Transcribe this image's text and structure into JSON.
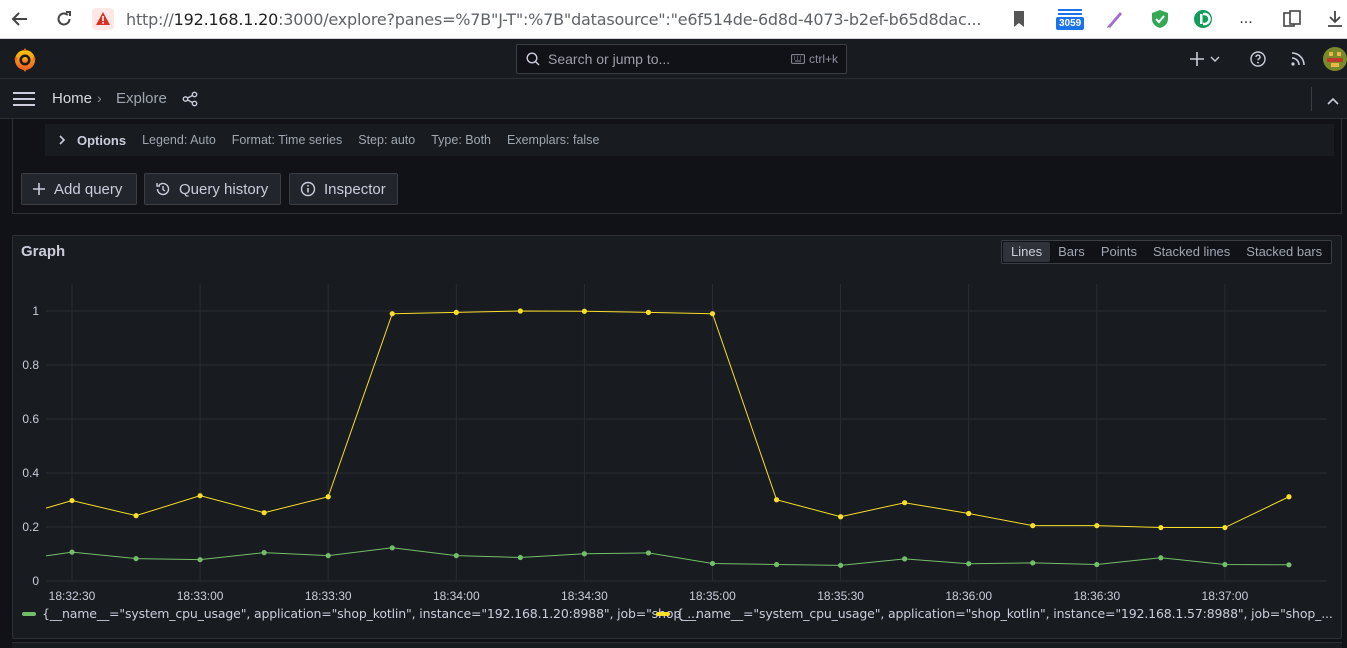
{
  "browser": {
    "url_prefix": "http://",
    "url_host": "192.168.1.20",
    "url_rest": ":3000/explore?panes=%7B\"J-T\":%7B\"datasource\":\"e6f514de-6d8d-4073-b2ef-b65d8dac...",
    "ext_badge": "3059",
    "more_label": "..."
  },
  "topbar": {
    "search_placeholder": "Search or jump to...",
    "search_shortcut": "ctrl+k"
  },
  "breadcrumb": {
    "home": "Home",
    "sep": "›",
    "current": "Explore"
  },
  "options": {
    "title": "Options",
    "items": [
      "Legend: Auto",
      "Format: Time series",
      "Step: auto",
      "Type: Both",
      "Exemplars: false"
    ]
  },
  "actions": {
    "add_query": "Add query",
    "query_history": "Query history",
    "inspector": "Inspector"
  },
  "graph": {
    "title": "Graph",
    "view_modes": [
      "Lines",
      "Bars",
      "Points",
      "Stacked lines",
      "Stacked bars"
    ],
    "active_mode": "Lines"
  },
  "colors": {
    "series_green": "#73bf69",
    "series_yellow": "#fade2a"
  },
  "chart_data": {
    "type": "line",
    "title": "",
    "xlabel": "",
    "ylabel": "",
    "ylim": [
      0,
      1.1
    ],
    "y_ticks": [
      "0",
      "0.2",
      "0.4",
      "0.6",
      "0.8",
      "1"
    ],
    "y_tick_values": [
      0,
      0.2,
      0.4,
      0.6,
      0.8,
      1
    ],
    "x_ticks": [
      "18:32:30",
      "18:33:00",
      "18:33:30",
      "18:34:00",
      "18:34:30",
      "18:35:00",
      "18:35:30",
      "18:36:00",
      "18:36:30",
      "18:37:00"
    ],
    "x": [
      "18:32:30",
      "18:32:45",
      "18:33:00",
      "18:33:15",
      "18:33:30",
      "18:33:45",
      "18:34:00",
      "18:34:15",
      "18:34:30",
      "18:34:45",
      "18:35:00",
      "18:35:15",
      "18:35:30",
      "18:35:45",
      "18:36:00",
      "18:36:15",
      "18:36:30",
      "18:36:45",
      "18:37:00",
      "18:37:15"
    ],
    "series": [
      {
        "name": "{__name__=\"system_cpu_usage\", application=\"shop_kotlin\", instance=\"192.168.1.20:8988\", job=\"shop_...",
        "color": "#73bf69",
        "left_edge_value": 0.093,
        "values": [
          0.107,
          0.083,
          0.079,
          0.105,
          0.094,
          0.123,
          0.094,
          0.087,
          0.101,
          0.104,
          0.065,
          0.061,
          0.058,
          0.082,
          0.064,
          0.067,
          0.061,
          0.086,
          0.061,
          0.06
        ]
      },
      {
        "name": "{__name__=\"system_cpu_usage\", application=\"shop_kotlin\", instance=\"192.168.1.57:8988\", job=\"shop_...",
        "color": "#fade2a",
        "left_edge_value": 0.27,
        "values": [
          0.298,
          0.242,
          0.316,
          0.253,
          0.312,
          0.99,
          0.995,
          1.0,
          0.999,
          0.995,
          0.99,
          0.301,
          0.238,
          0.29,
          0.25,
          0.205,
          0.205,
          0.198,
          0.198,
          0.312
        ]
      }
    ],
    "legend_position": "bottom",
    "grid": true
  }
}
